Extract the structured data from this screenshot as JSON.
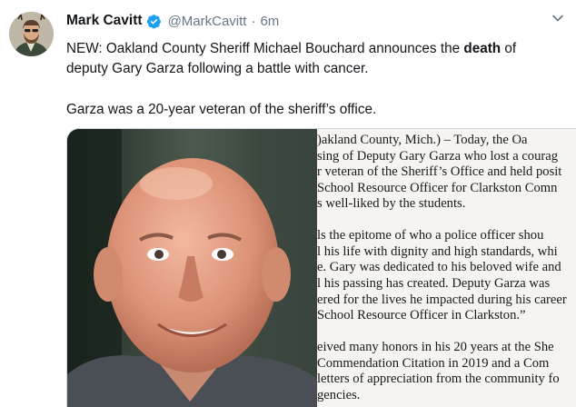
{
  "tweet": {
    "author_name": "Mark Cavitt",
    "handle": "@MarkCavitt",
    "separator": "·",
    "time": "6m",
    "text_line1": "NEW: Oakland County Sheriff Michael Bouchard announces the ",
    "text_line1_bold": "death",
    "text_line1_end": " of",
    "text_line2": "deputy Gary Garza following a battle with cancer.",
    "text_line3": "Garza was a 20-year veteran of the sheriff’s office."
  },
  "document": {
    "lines": [
      ")akland County, Mich.) – Today, the Oa",
      "sing of Deputy Gary Garza who lost a courag",
      "r veteran of the Sheriff’s Office and held posit",
      "School Resource Officer for Clarkston Comn",
      "s well-liked by the students.",
      "",
      "ls the epitome of who a police officer shou",
      "l his life with dignity and high standards, whi",
      "e. Gary was dedicated to his beloved wife and",
      "l his passing has created. Deputy Garza was",
      "ered for the lives he impacted during his career",
      "School Resource Officer in Clarkston.”",
      "",
      "eived many honors in his 20 years at the She",
      "Commendation Citation in 2019 and a Com",
      "letters of appreciation from the community fo",
      "gencies."
    ]
  },
  "colors": {
    "verified": "#1da1f2",
    "secondary_text": "#657786",
    "primary_text": "#14171a"
  }
}
